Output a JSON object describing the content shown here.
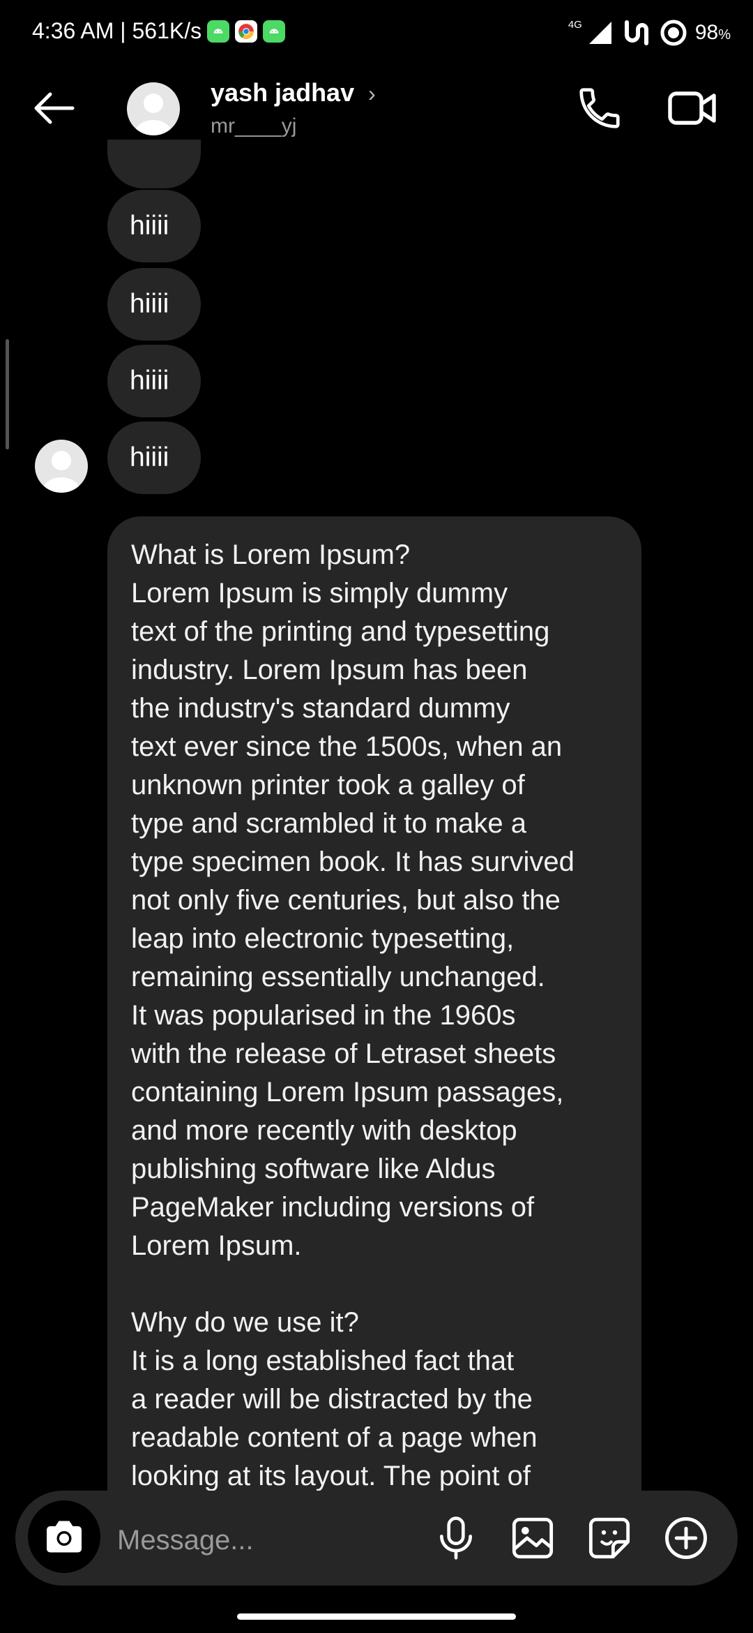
{
  "status_bar": {
    "time_info": "4:36 AM | 561K/s",
    "network": "4G",
    "battery": "98",
    "battery_unit": "%"
  },
  "header": {
    "contact_name": "yash jadhav",
    "chevron": "›",
    "username": "mr____yj"
  },
  "messages": {
    "short": [
      "hiiii",
      "hiiii",
      "hiiii",
      "hiiii"
    ],
    "long_text": "What is Lorem Ipsum?\nLorem Ipsum is simply dummy\ntext of the printing and typesetting\nindustry. Lorem Ipsum has been\nthe industry's standard dummy\ntext ever since the 1500s, when an\nunknown printer took a galley of\ntype and scrambled it to make a\ntype specimen book. It has survived\nnot only five centuries, but also the\nleap into electronic typesetting,\nremaining essentially unchanged.\nIt was popularised in the 1960s\nwith the release of Letraset sheets\ncontaining Lorem Ipsum passages,\nand more recently with desktop\npublishing software like Aldus\nPageMaker including versions of\nLorem Ipsum.\n\nWhy do we use it?\nIt is a long established fact that\na reader will be distracted by the\nreadable content of a page when\nlooking at its layout. The point of"
  },
  "composer": {
    "placeholder": "Message..."
  },
  "icons": [
    "back-arrow-icon",
    "phone-icon",
    "video-camera-icon",
    "camera-icon",
    "microphone-icon",
    "gallery-icon",
    "sticker-icon",
    "plus-circle-icon"
  ],
  "colors": {
    "background": "#000000",
    "bubble": "#262626",
    "badge_green": "#4cd964"
  }
}
